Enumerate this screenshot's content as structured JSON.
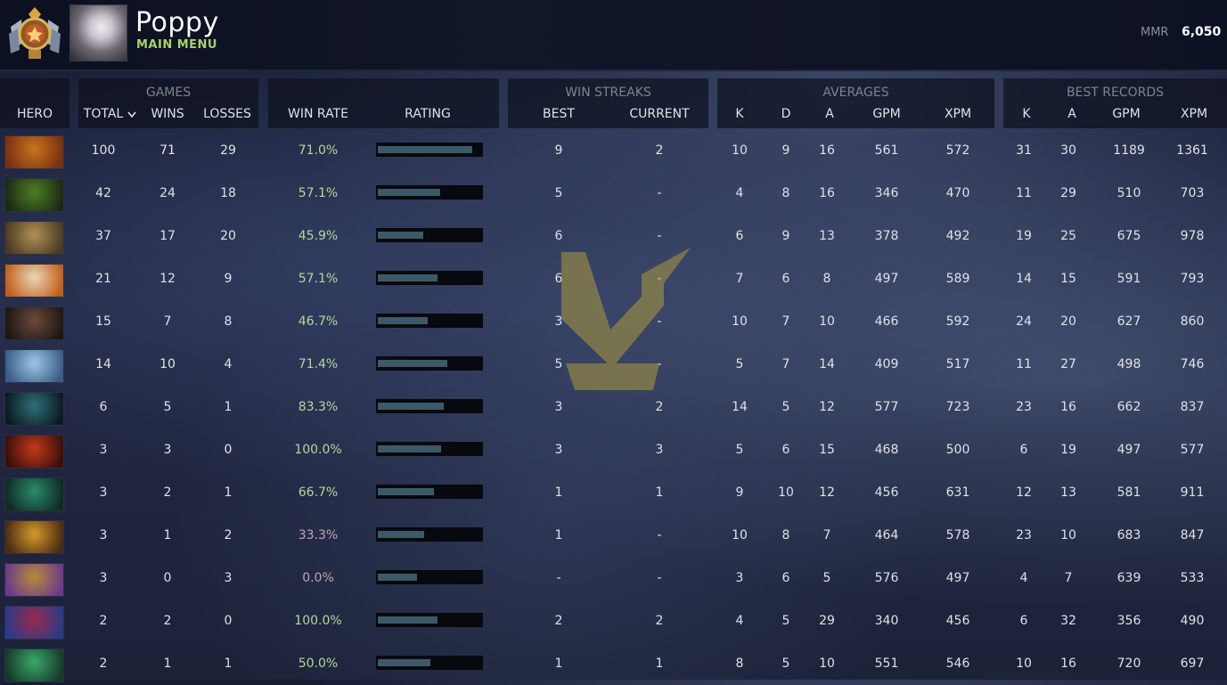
{
  "profile": {
    "name": "Poppy",
    "menu_link": "MAIN MENU",
    "mmr_label": "MMR",
    "mmr_value": "6,050"
  },
  "table": {
    "groups": {
      "games": "GAMES",
      "win_streaks": "WIN STREAKS",
      "averages": "AVERAGES",
      "best_records": "BEST RECORDS"
    },
    "columns": {
      "hero": "HERO",
      "total": "TOTAL",
      "wins": "WINS",
      "losses": "LOSSES",
      "win_rate": "WIN RATE",
      "rating": "RATING",
      "best": "BEST",
      "current": "CURRENT",
      "avg_k": "K",
      "avg_d": "D",
      "avg_a": "A",
      "avg_gpm": "GPM",
      "avg_xpm": "XPM",
      "best_k": "K",
      "best_a": "A",
      "best_gpm": "GPM",
      "best_xpm": "XPM"
    },
    "sort_icon": "chevron-down-icon",
    "rows": [
      {
        "total": "100",
        "wins": "71",
        "losses": "29",
        "win_rate": "71.0%",
        "rating": 0.91,
        "best": "9",
        "current": "2",
        "k": "10",
        "d": "9",
        "a": "16",
        "gpm": "561",
        "xpm": "572",
        "bk": "31",
        "ba": "30",
        "bgpm": "1189",
        "bxpm": "1361",
        "colors": [
          "#c9741f",
          "#7a2f10"
        ]
      },
      {
        "total": "42",
        "wins": "24",
        "losses": "18",
        "win_rate": "57.1%",
        "rating": 0.6,
        "best": "5",
        "current": "-",
        "k": "4",
        "d": "8",
        "a": "16",
        "gpm": "346",
        "xpm": "470",
        "bk": "11",
        "ba": "29",
        "bgpm": "510",
        "bxpm": "703",
        "colors": [
          "#4e7d24",
          "#1b2a14"
        ]
      },
      {
        "total": "37",
        "wins": "17",
        "losses": "20",
        "win_rate": "45.9%",
        "rating": 0.44,
        "best": "6",
        "current": "-",
        "k": "6",
        "d": "9",
        "a": "13",
        "gpm": "378",
        "xpm": "492",
        "bk": "19",
        "ba": "25",
        "bgpm": "675",
        "bxpm": "978",
        "colors": [
          "#b09055",
          "#4a3a22"
        ]
      },
      {
        "total": "21",
        "wins": "12",
        "losses": "9",
        "win_rate": "57.1%",
        "rating": 0.58,
        "best": "6",
        "current": "-",
        "k": "7",
        "d": "6",
        "a": "8",
        "gpm": "497",
        "xpm": "589",
        "bk": "14",
        "ba": "15",
        "bgpm": "591",
        "bxpm": "793",
        "colors": [
          "#e8d6b8",
          "#c25d19"
        ]
      },
      {
        "total": "15",
        "wins": "7",
        "losses": "8",
        "win_rate": "46.7%",
        "rating": 0.48,
        "best": "3",
        "current": "-",
        "k": "10",
        "d": "7",
        "a": "10",
        "gpm": "466",
        "xpm": "592",
        "bk": "24",
        "ba": "20",
        "bgpm": "627",
        "bxpm": "860",
        "colors": [
          "#6b4a3a",
          "#1e1614"
        ]
      },
      {
        "total": "14",
        "wins": "10",
        "losses": "4",
        "win_rate": "71.4%",
        "rating": 0.67,
        "best": "5",
        "current": "-",
        "k": "5",
        "d": "7",
        "a": "14",
        "gpm": "409",
        "xpm": "517",
        "bk": "11",
        "ba": "27",
        "bgpm": "498",
        "bxpm": "746",
        "colors": [
          "#9cc7e6",
          "#3b5b86"
        ]
      },
      {
        "total": "6",
        "wins": "5",
        "losses": "1",
        "win_rate": "83.3%",
        "rating": 0.64,
        "best": "3",
        "current": "2",
        "k": "14",
        "d": "5",
        "a": "12",
        "gpm": "577",
        "xpm": "723",
        "bk": "23",
        "ba": "16",
        "bgpm": "662",
        "bxpm": "837",
        "colors": [
          "#2f6f78",
          "#0b1a22"
        ]
      },
      {
        "total": "3",
        "wins": "3",
        "losses": "0",
        "win_rate": "100.0%",
        "rating": 0.61,
        "best": "3",
        "current": "3",
        "k": "5",
        "d": "6",
        "a": "15",
        "gpm": "468",
        "xpm": "500",
        "bk": "6",
        "ba": "19",
        "bgpm": "497",
        "bxpm": "577",
        "colors": [
          "#c23a1a",
          "#3a0e0a"
        ]
      },
      {
        "total": "3",
        "wins": "2",
        "losses": "1",
        "win_rate": "66.7%",
        "rating": 0.54,
        "best": "1",
        "current": "1",
        "k": "9",
        "d": "10",
        "a": "12",
        "gpm": "456",
        "xpm": "631",
        "bk": "12",
        "ba": "13",
        "bgpm": "581",
        "bxpm": "911",
        "colors": [
          "#2a8a6a",
          "#0f2a24"
        ]
      },
      {
        "total": "3",
        "wins": "1",
        "losses": "2",
        "win_rate": "33.3%",
        "rating": 0.45,
        "best": "1",
        "current": "-",
        "k": "10",
        "d": "8",
        "a": "7",
        "gpm": "464",
        "xpm": "578",
        "bk": "23",
        "ba": "10",
        "bgpm": "683",
        "bxpm": "847",
        "colors": [
          "#d39a2a",
          "#4a2a12"
        ]
      },
      {
        "total": "3",
        "wins": "0",
        "losses": "3",
        "win_rate": "0.0%",
        "rating": 0.38,
        "best": "-",
        "current": "-",
        "k": "3",
        "d": "6",
        "a": "5",
        "gpm": "576",
        "xpm": "497",
        "bk": "4",
        "ba": "7",
        "bgpm": "639",
        "bxpm": "533",
        "colors": [
          "#b88a3a",
          "#6a3a8a"
        ]
      },
      {
        "total": "2",
        "wins": "2",
        "losses": "0",
        "win_rate": "100.0%",
        "rating": 0.58,
        "best": "2",
        "current": "2",
        "k": "4",
        "d": "5",
        "a": "29",
        "gpm": "340",
        "xpm": "456",
        "bk": "6",
        "ba": "32",
        "bgpm": "356",
        "bxpm": "490",
        "colors": [
          "#9a2a4a",
          "#2a3a8a"
        ]
      },
      {
        "total": "2",
        "wins": "1",
        "losses": "1",
        "win_rate": "50.0%",
        "rating": 0.51,
        "best": "1",
        "current": "1",
        "k": "8",
        "d": "5",
        "a": "10",
        "gpm": "551",
        "xpm": "546",
        "bk": "10",
        "ba": "16",
        "bgpm": "720",
        "bxpm": "697",
        "colors": [
          "#3aa86a",
          "#143a2a"
        ]
      }
    ]
  }
}
